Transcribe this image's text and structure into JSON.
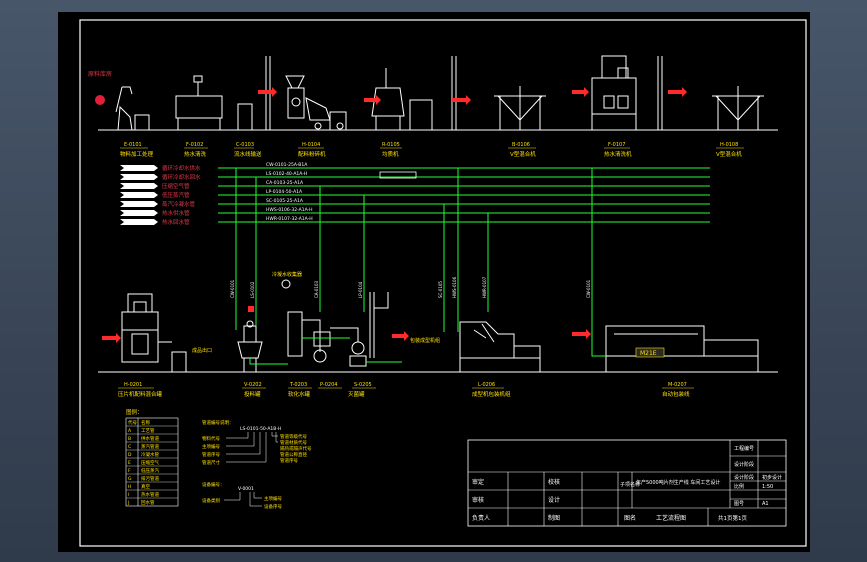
{
  "drawing": {
    "top_label_warehouse": "原料库房",
    "top_captions": [
      "物料加工处理",
      "热水清洗",
      "流水线输送",
      "配料粉碎机",
      "均质机",
      "V型混合机",
      "热水清洗机",
      "V型混合机"
    ],
    "top_codes": [
      "E-0101",
      "F-0102",
      "C-0103",
      "H-0104",
      "R-0105",
      "B-0106",
      "F-0107",
      "H-0108"
    ],
    "pipe_labels": [
      "循环冷却水供水",
      "循环冷却水回水",
      "压缩空气管",
      "低压蒸汽管",
      "蒸汽冷凝水管",
      "热水供水管",
      "热水回水管"
    ],
    "pipe_codes": [
      "CW-0101-25A-B1A",
      "LS-0102-40-A1A-H",
      "CA-0103-25-A1A",
      "LP-0104-50-A1A",
      "SC-0105-25-A1A",
      "HWS-0106-32-A1A-H",
      "HWR-0107-32-A1A-H"
    ],
    "bottom_label_steam": "冷凝水收集器",
    "bottom_label_outlet": "成品出口",
    "bottom_label_packing": "包装成型机组",
    "bottom_captions": [
      "压片机配料混合罐",
      "投料罐",
      "软化水罐",
      "灭菌罐",
      "成型机包装机组",
      "自动包装线"
    ],
    "bottom_codes": [
      "H-0201",
      "V-0202",
      "T-0203",
      "P-0204",
      "S-0205",
      "L-0206",
      "M-0207"
    ],
    "machine_badge": "M21E",
    "legend_title": "图例：",
    "legend_rows": [
      {
        "code": "代号",
        "name": "名称"
      },
      {
        "code": "A",
        "name": "工艺管"
      },
      {
        "code": "B",
        "name": "供水管道"
      },
      {
        "code": "C",
        "name": "蒸汽管道"
      },
      {
        "code": "D",
        "name": "冷凝水管"
      },
      {
        "code": "E",
        "name": "压缩空气"
      },
      {
        "code": "F",
        "name": "低压蒸汽"
      },
      {
        "code": "G",
        "name": "排污管道"
      },
      {
        "code": "H",
        "name": "真空"
      },
      {
        "code": "I",
        "name": "热水管道"
      },
      {
        "code": "J",
        "name": "回水管"
      }
    ],
    "pipe_note_title": "管道编号说明：",
    "pipe_note_code": "LS-0101-50-A1B-H",
    "pipe_note_left": [
      "物料代号",
      "主项编号",
      "管道序号",
      "管道尺寸"
    ],
    "pipe_note_right": [
      "管道等级代号",
      "管道材质代号",
      "隔热或隔声代号",
      "管道公称直径",
      "管道序号"
    ],
    "equip_note_title": "设备编号：",
    "equip_note_code": "V-0001",
    "equip_note_left": "设备类别",
    "equip_note_right": [
      "主项编号",
      "设备序号"
    ]
  },
  "title_block": {
    "r1c1": "审定",
    "r1c3": "校核",
    "r2c1": "审核",
    "r2c3": "设计",
    "r3c1": "负责人",
    "r3c3": "制图",
    "project_label": "子项名称",
    "project_value": "年产5000吨片剂生产线 车间工艺设计",
    "drawing_label": "图名",
    "drawing_value": "工艺流程图",
    "stage_label": "设计阶段",
    "stage_value": "初步设计",
    "scale_label": "比例",
    "scale_value": "1:50",
    "no_label": "图号",
    "no_value": "A1",
    "sheet_text": "共1页第1页",
    "top_right_a": "工程编号",
    "top_right_b": "设计阶段"
  }
}
